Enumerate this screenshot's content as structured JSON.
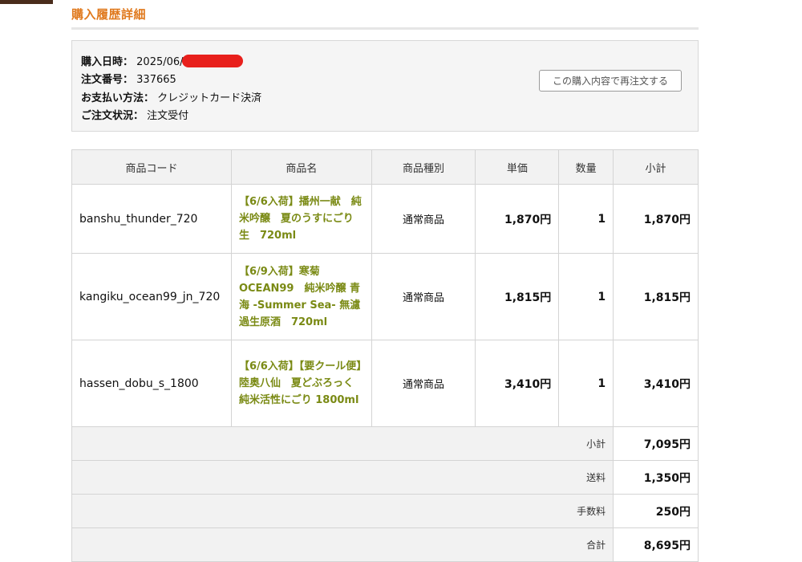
{
  "page": {
    "title": "購入履歴詳細"
  },
  "order": {
    "date_label": "購入日時：",
    "date_value": "2025/06/0",
    "number_label": "注文番号：",
    "number_value": "337665",
    "payment_label": "お支払い方法：",
    "payment_value": "クレジットカード決済",
    "status_label": "ご注文状況：",
    "status_value": "注文受付",
    "reorder_button": "この購入内容で再注文する"
  },
  "table": {
    "headers": [
      "商品コード",
      "商品名",
      "商品種別",
      "単価",
      "数量",
      "小計"
    ],
    "rows": [
      {
        "code": "banshu_thunder_720",
        "name": "【6/6入荷】播州一献　純米吟醸　夏のうすにごり　生　720ml",
        "type": "通常商品",
        "price": "1,870円",
        "qty": "1",
        "subtotal": "1,870円"
      },
      {
        "code": "kangiku_ocean99_jn_720",
        "name": "【6/9入荷】寒菊 OCEAN99　純米吟醸 青海 -Summer Sea- 無濾過生原酒　720ml",
        "type": "通常商品",
        "price": "1,815円",
        "qty": "1",
        "subtotal": "1,815円"
      },
      {
        "code": "hassen_dobu_s_1800",
        "name": "【6/6入荷】【要クール便】陸奥八仙　夏どぶろっく　純米活性にごり 1800ml",
        "type": "通常商品",
        "price": "3,410円",
        "qty": "1",
        "subtotal": "3,410円"
      }
    ],
    "summary": [
      {
        "label": "小計",
        "value": "7,095円"
      },
      {
        "label": "送料",
        "value": "1,350円"
      },
      {
        "label": "手数料",
        "value": "250円"
      },
      {
        "label": "合計",
        "value": "8,695円"
      }
    ]
  },
  "colors": {
    "title_orange": "#e07a1f",
    "product_link_olive": "#7a8a14",
    "redaction_red": "#e8201c"
  }
}
